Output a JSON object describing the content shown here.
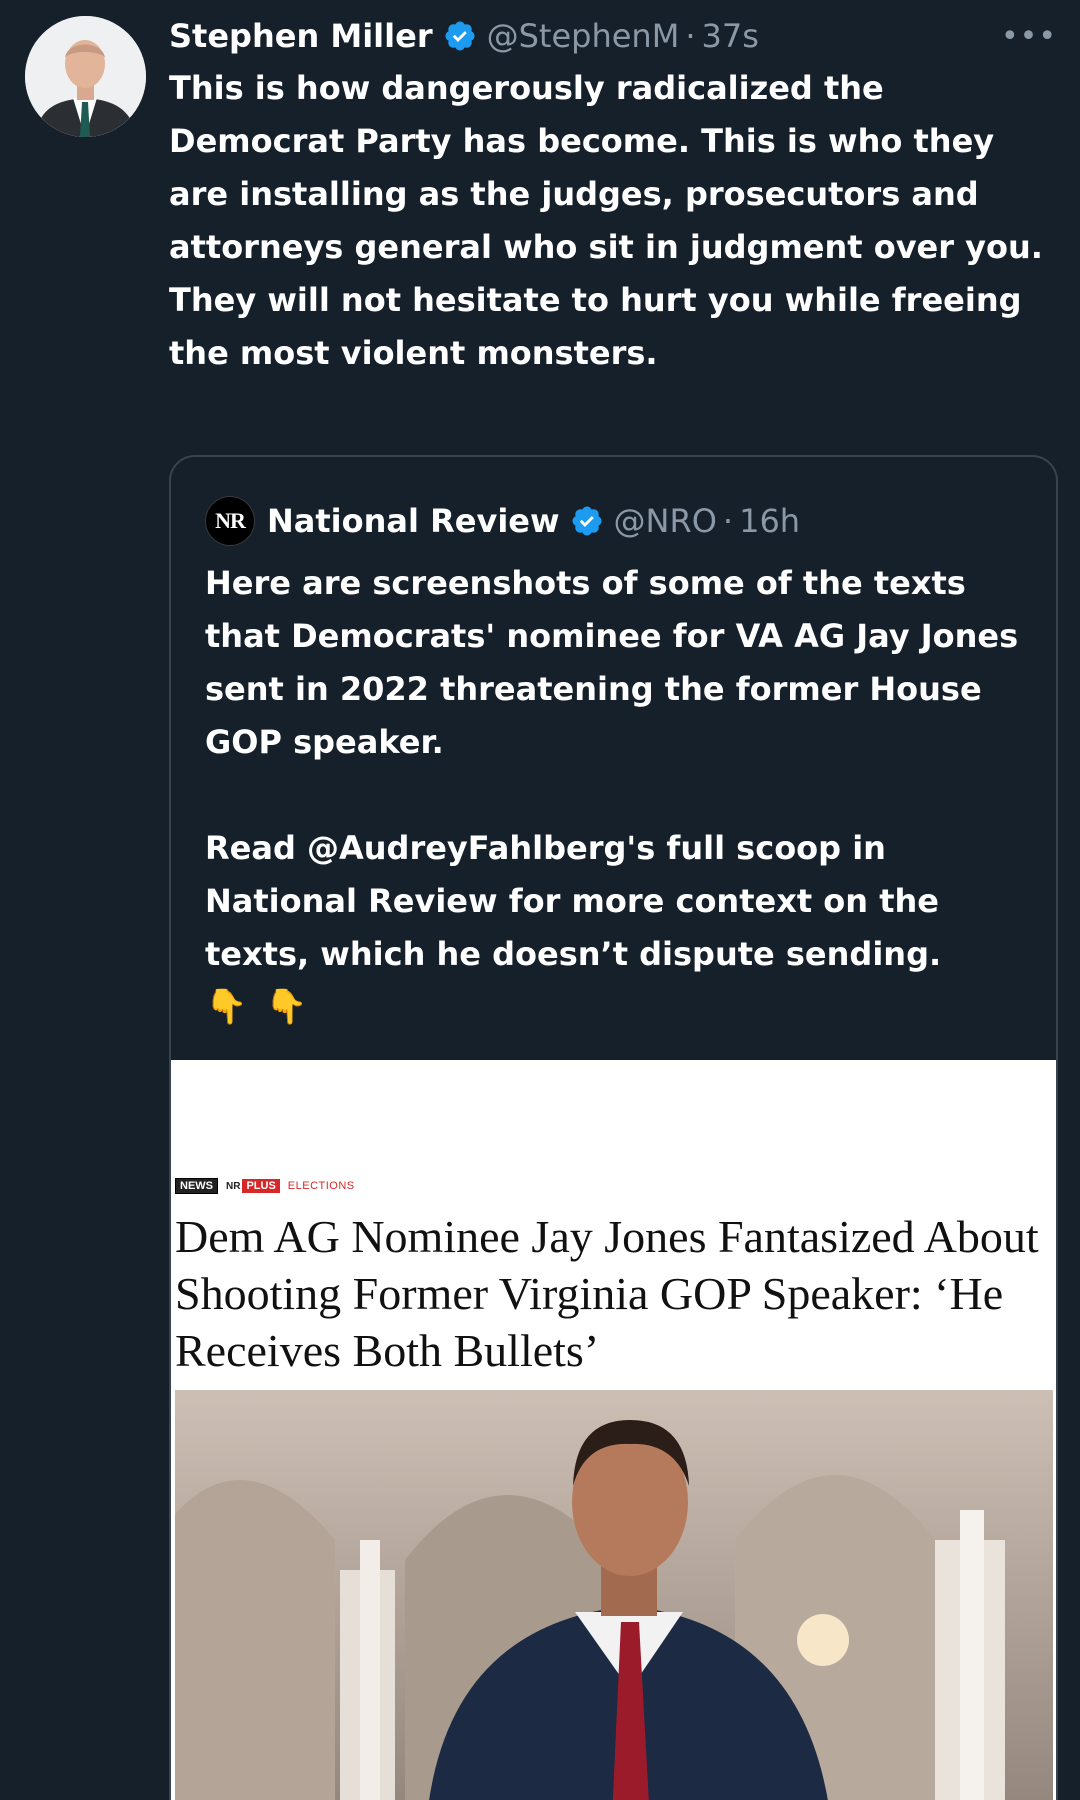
{
  "tweet": {
    "author_name": "Stephen Miller",
    "handle": "@StephenM",
    "separator": "·",
    "time": "37s",
    "more_label": "•••",
    "text": "This is how dangerously radicalized the Democrat Party has become. This is who they are installing as the judges, prosecutors and attorneys general who sit in judgment over you. They will not hesitate to hurt you while freeing the most violent monsters."
  },
  "quoted_tweet": {
    "logo_text": "NR",
    "author_name": "National Review",
    "handle": "@NRO",
    "separator": "·",
    "time": "16h",
    "paragraph_1": "Here are screenshots of some of the texts that Democrats' nominee for VA AG Jay Jones sent in 2022 threatening the former House GOP speaker.",
    "paragraph_2": "Read @AudreyFahlberg's full scoop in National Review for more context on the texts, which he doesn’t dispute sending.",
    "emoji": [
      "👇",
      "👇"
    ]
  },
  "article": {
    "tag_news": "NEWS",
    "tag_nr": "NR",
    "tag_plus": "PLUS",
    "tag_elections": "ELECTIONS",
    "headline": "Dem AG Nominee Jay Jones Fantasized About Shooting Former Virginia GOP Speaker: ‘He Receives Both Bullets’"
  },
  "colors": {
    "background": "#15202b",
    "text": "#ffffff",
    "secondary_text": "#8b98a5",
    "verified_badge": "#1d9bf0",
    "card_border": "#38444d",
    "tag_red": "#d62828"
  },
  "icons": {
    "verified": "verified-badge-icon",
    "more": "more-horizontal-icon"
  }
}
